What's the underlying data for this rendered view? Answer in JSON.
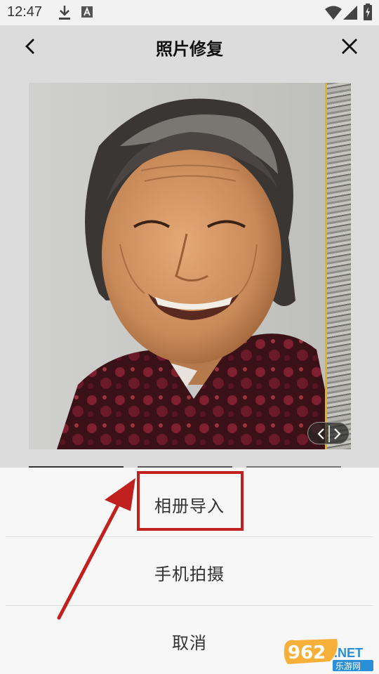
{
  "status_bar": {
    "time": "12:47",
    "icons": [
      "download-icon",
      "font-a-icon",
      "wifi-icon",
      "signal-icon",
      "battery-icon"
    ]
  },
  "header": {
    "title": "照片修复",
    "back_icon": "chevron-left-icon",
    "close_icon": "close-icon"
  },
  "photo": {
    "description_icon": "portrait-photo",
    "compare_toggle_icons": [
      "chevron-left-icon",
      "chevron-right-icon"
    ]
  },
  "sheet": {
    "items": [
      {
        "label": "相册导入"
      },
      {
        "label": "手机拍摄"
      },
      {
        "label": "取消"
      }
    ]
  },
  "watermark": {
    "text_top": "962",
    "text_net": ".NET",
    "text_bottom": "乐游网"
  },
  "colors": {
    "highlight": "#c0211e",
    "compare_line": "#e6b412"
  }
}
